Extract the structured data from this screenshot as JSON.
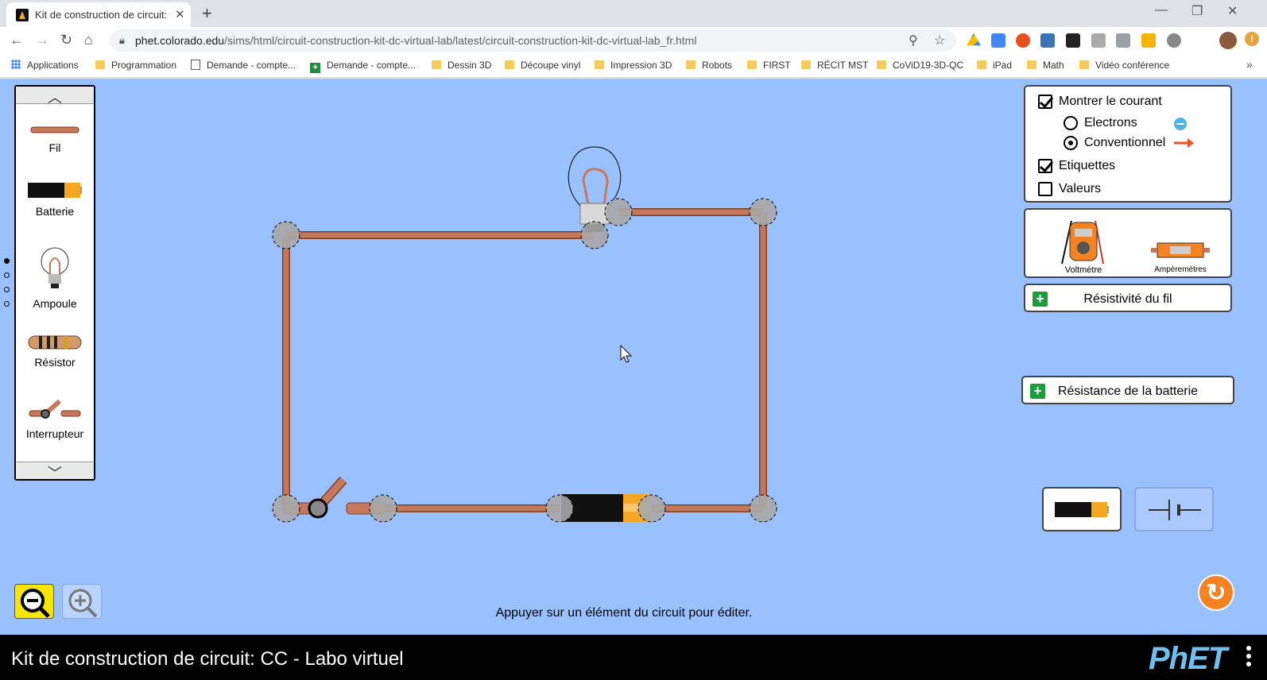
{
  "browser": {
    "tab_title": "Kit de construction de circuit: CC",
    "tab_close": "✕",
    "new_tab": "+",
    "url_host": "phet.colorado.edu",
    "url_path": "/sims/html/circuit-construction-kit-dc-virtual-lab/latest/circuit-construction-kit-dc-virtual-lab_fr.html",
    "minimize": "—",
    "restore": "❐",
    "close": "✕",
    "more_bookmarks": "»"
  },
  "bookmarks": [
    {
      "label": "Applications",
      "icon": "apps-grid-icon"
    },
    {
      "label": "Programmation",
      "icon": "folder-icon"
    },
    {
      "label": "Demande - compte...",
      "icon": "doc-icon"
    },
    {
      "label": "Demande - compte...",
      "icon": "sheet-icon"
    },
    {
      "label": "Dessin 3D",
      "icon": "folder-icon"
    },
    {
      "label": "Découpe vinyl",
      "icon": "folder-icon"
    },
    {
      "label": "Impression 3D",
      "icon": "folder-icon"
    },
    {
      "label": "Robots",
      "icon": "folder-icon"
    },
    {
      "label": "FIRST",
      "icon": "folder-icon"
    },
    {
      "label": "RÉCIT MST",
      "icon": "folder-icon"
    },
    {
      "label": "CoViD19-3D-QC",
      "icon": "folder-icon"
    },
    {
      "label": "iPad",
      "icon": "folder-icon"
    },
    {
      "label": "Math",
      "icon": "folder-icon"
    },
    {
      "label": "Vidéo conférence",
      "icon": "folder-icon"
    }
  ],
  "carousel": {
    "items": [
      {
        "label": "Fil",
        "icon": "wire-icon"
      },
      {
        "label": "Batterie",
        "icon": "battery-icon"
      },
      {
        "label": "Ampoule",
        "icon": "lightbulb-icon"
      },
      {
        "label": "Résistor",
        "icon": "resistor-icon"
      },
      {
        "label": "Interrupteur",
        "icon": "switch-icon"
      }
    ]
  },
  "controls": {
    "show_current": "Montrer le courant",
    "electrons": "Electrons",
    "conventional": "Conventionnel",
    "labels": "Etiquettes",
    "values": "Valeurs"
  },
  "tools": {
    "voltmeter": "Voltmètre",
    "ammeter": "Ampèremètres"
  },
  "buttons": {
    "wire_resistivity": "Résistivité du fil",
    "battery_resistance": "Résistance de la batterie"
  },
  "hint": "Appuyer sur un élément du circuit pour éditer.",
  "footer": {
    "title": "Kit de construction de circuit: CC - Labo virtuel",
    "logo": "PhET"
  },
  "colors": {
    "sim_bg": "#99c0ff",
    "wire": "#c6785a",
    "accent_orange": "#f58220"
  }
}
